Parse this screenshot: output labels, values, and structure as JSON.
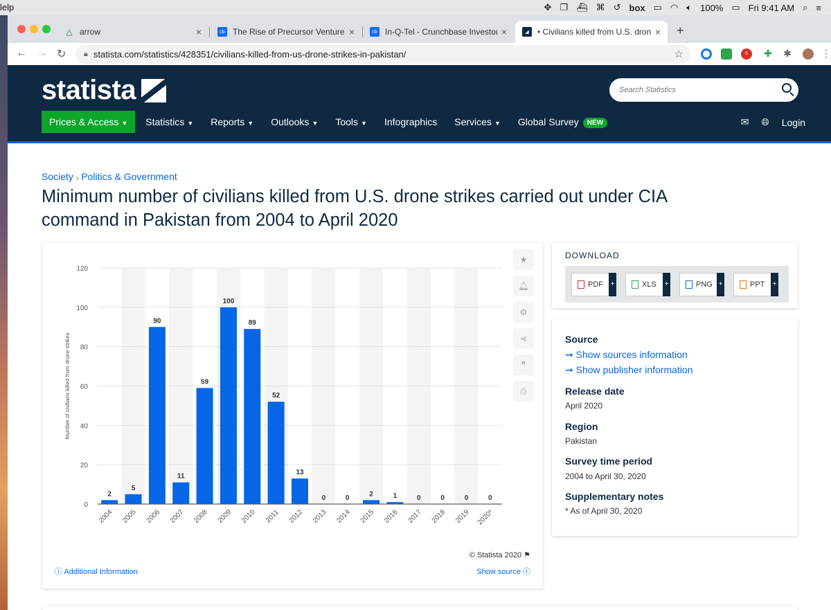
{
  "menubar": {
    "app_fragment": "lelp",
    "battery": "100%",
    "clock": "Fri 9:41 AM",
    "box_label": "box"
  },
  "tabs": [
    {
      "title": "arrow",
      "favicon": "arrow-triangle-icon"
    },
    {
      "title": "The Rise of Precursor Ventures",
      "favicon": "cb"
    },
    {
      "title": "In-Q-Tel - Crunchbase Investor",
      "favicon": "cb"
    },
    {
      "title": "• Civilians killed from U.S. dron",
      "favicon": "statista-icon"
    }
  ],
  "address": {
    "url": "statista.com/statistics/428351/civilians-killed-from-us-drone-strikes-in-pakistan/"
  },
  "extensions": {
    "abp_count": "6"
  },
  "statista": {
    "logo": "statista",
    "search_placeholder": "Search Statistics",
    "nav": [
      "Prices & Access",
      "Statistics",
      "Reports",
      "Outlooks",
      "Tools",
      "Infographics",
      "Services",
      "Global Survey"
    ],
    "nav_badge": "NEW",
    "login": "Login"
  },
  "breadcrumb": [
    "Society",
    "Politics & Government"
  ],
  "title": "Minimum number of civilians killed from U.S. drone strikes carried out under CIA command in Pakistan from 2004 to April 2020",
  "chart_footer": {
    "copyright": "© Statista 2020",
    "additional_info": "Additional Information",
    "show_source": "Show source"
  },
  "download": {
    "title": "DOWNLOAD",
    "buttons": [
      "PDF",
      "XLS",
      "PNG",
      "PPT"
    ]
  },
  "info": {
    "source_heading": "Source",
    "source_link_1": "Show sources information",
    "source_link_2": "Show publisher information",
    "release_heading": "Release date",
    "release_value": "April 2020",
    "region_heading": "Region",
    "region_value": "Pakistan",
    "period_heading": "Survey time period",
    "period_value": "2004 to April 30, 2020",
    "notes_heading": "Supplementary notes",
    "notes_value": "* As of April 30, 2020"
  },
  "colors": {
    "navy": "#0f2942",
    "bar": "#0666e5",
    "green": "#0ca62a"
  },
  "chart_data": {
    "type": "bar",
    "categories": [
      "2004",
      "2005",
      "2006",
      "2007",
      "2008",
      "2009",
      "2010",
      "2011",
      "2012",
      "2013",
      "2014",
      "2015",
      "2016",
      "2017",
      "2018",
      "2019",
      "2020*"
    ],
    "values": [
      2,
      5,
      90,
      11,
      59,
      100,
      89,
      52,
      13,
      0,
      0,
      2,
      1,
      0,
      0,
      0,
      0
    ],
    "ylabel": "Number of civilians killed from drone strikes",
    "ylim": [
      0,
      120
    ],
    "yticks": [
      0,
      20,
      40,
      60,
      80,
      100,
      120
    ],
    "data_labels": true,
    "grid": true
  }
}
